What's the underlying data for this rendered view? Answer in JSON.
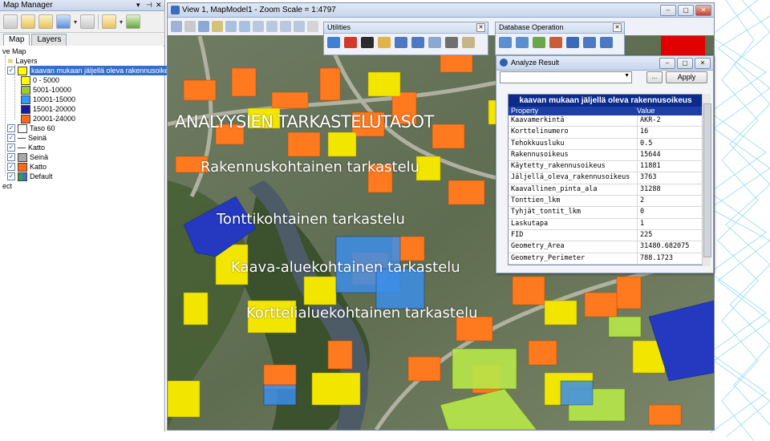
{
  "map_manager": {
    "title": "Map Manager",
    "tabs": [
      {
        "label": "Map"
      },
      {
        "label": "Layers"
      }
    ],
    "tree": {
      "root": "ve Map",
      "layers_node": "Layers",
      "selected_layer": "kaavan mukaan jäljellä oleva rakennusoikeus",
      "legend": [
        {
          "label": "0 - 5000",
          "color": "#ffff00"
        },
        {
          "label": "5001-10000",
          "color": "#9acd32"
        },
        {
          "label": "10001-15000",
          "color": "#3399ff"
        },
        {
          "label": "15001-20000",
          "color": "#1a1aa0"
        },
        {
          "label": "20001-24000",
          "color": "#ff6a1a"
        }
      ],
      "layers": [
        {
          "label": "Taso 60",
          "checked": true,
          "swatch": "box-white"
        },
        {
          "label": "Seinä",
          "checked": true,
          "swatch": "line"
        },
        {
          "label": "Katto",
          "checked": true,
          "swatch": "line"
        },
        {
          "label": "Seinä",
          "checked": true,
          "swatch": "grey"
        },
        {
          "label": "Katto",
          "checked": true,
          "swatch": "orange"
        },
        {
          "label": "Default",
          "checked": true,
          "swatch": "multi"
        }
      ],
      "trailing": "ect"
    }
  },
  "map_view": {
    "title": "View 1, MapModel1 - Zoom Scale = 1:4797"
  },
  "utilities": {
    "title": "Utilities"
  },
  "database_operation": {
    "title": "Database Operation"
  },
  "analyze_result": {
    "title": "Analyze Result",
    "apply_label": "Apply",
    "browse_label": "...",
    "table_title": "kaavan mukaan jäljellä oleva rakennusoikeus",
    "col_property": "Property",
    "col_value": "Value",
    "rows": [
      {
        "property": "Kaavamerkintä",
        "value": "AKR-2"
      },
      {
        "property": "Korttelinumero",
        "value": "16"
      },
      {
        "property": "Tehokkuusluku",
        "value": "0.5"
      },
      {
        "property": "Rakennusoikeus",
        "value": "15644"
      },
      {
        "property": "Käytetty_rakennusoikeus",
        "value": "11881"
      },
      {
        "property": "Jäljellä_oleva_rakennusoikeus",
        "value": "3763"
      },
      {
        "property": "Kaavallinen_pinta_ala",
        "value": "31288"
      },
      {
        "property": "Tonttien_lkm",
        "value": "2"
      },
      {
        "property": "Tyhjät_tontit_lkm",
        "value": "0"
      },
      {
        "property": "Laskutapa",
        "value": "1"
      },
      {
        "property": "FID",
        "value": "225"
      },
      {
        "property": "Geometry_Area",
        "value": "31480.682075"
      },
      {
        "property": "Geometry_Perimeter",
        "value": "788.1723"
      }
    ]
  },
  "overlay": {
    "title": "ANALYYSIEN TARKASTELUTASOT",
    "levels": [
      "Rakennuskohtainen tarkastelu",
      "Tonttikohtainen tarkastelu",
      "Kaava-aluekohtainen tarkastelu",
      "Korttelialuekohtainen tarkastelu"
    ]
  }
}
